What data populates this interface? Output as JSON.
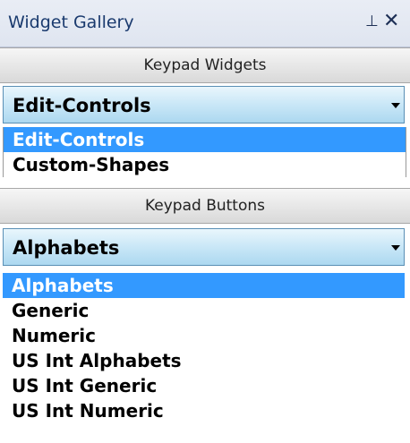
{
  "panel": {
    "title": "Widget Gallery",
    "pin_glyph": "⊥",
    "close_glyph": "✕"
  },
  "keypad_widgets": {
    "header": "Keypad Widgets",
    "selected": "Edit-Controls",
    "options": [
      "Edit-Controls",
      "Custom-Shapes"
    ]
  },
  "keypad_buttons": {
    "header": "Keypad Buttons",
    "selected": "Alphabets",
    "options": [
      "Alphabets",
      "Generic",
      "Numeric",
      "US Int Alphabets",
      "US Int Generic",
      "US Int Numeric"
    ]
  },
  "colors": {
    "highlight": "#3399ff",
    "title_text": "#1a3a6e"
  },
  "icons": {
    "pin": "pin-icon",
    "close": "close-icon",
    "dropdown": "chevron-down-icon"
  }
}
